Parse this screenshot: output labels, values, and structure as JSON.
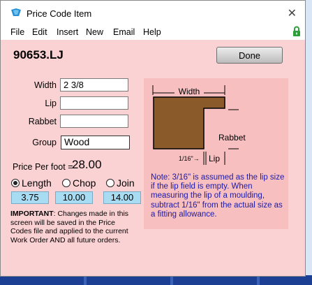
{
  "window": {
    "title": "Price Code Item",
    "close_glyph": "✕"
  },
  "menu": {
    "items": [
      "File",
      "Edit",
      "Insert",
      "New",
      "Email",
      "Help"
    ]
  },
  "item": {
    "code": "90653.LJ"
  },
  "toolbar": {
    "done_label": "Done"
  },
  "fields": {
    "width_label": "Width",
    "width_value": "2  3/8",
    "lip_label": "Lip",
    "lip_value": "",
    "rabbet_label": "Rabbet",
    "rabbet_value": "",
    "group_label": "Group",
    "group_value": "Wood"
  },
  "price": {
    "label": "Price Per foot =",
    "value": "28.00"
  },
  "pricing_options": [
    {
      "label": "Length",
      "value": "3.75",
      "selected": true
    },
    {
      "label": "Chop",
      "value": "10.00",
      "selected": false
    },
    {
      "label": "Join",
      "value": "14.00",
      "selected": false
    }
  ],
  "important_note": {
    "bold": "IMPORTANT",
    "text": ": Changes made in this screen will be saved in the Price Codes file and applied to the current Work Order AND all future orders."
  },
  "diagram": {
    "width_label": "Width",
    "rabbet_label": "Rabbet",
    "sixteenth_label": "1/16\"→",
    "lip_label": "Lip",
    "moulding_color": "#8b5a2b"
  },
  "note": {
    "text": "Note: 3/16\" is assumed as the lip size if the lip field is empty. When measuring the lip of a moulding, subtract 1/16\" from the actual size as a fitting allowance."
  },
  "colors": {
    "window_bg": "#fbd2d3",
    "panel_bg": "#f8bfc1",
    "note_text": "#1a1aa8",
    "value_box": "#a8dcf3",
    "lock": "#2e9e3a"
  },
  "icons": {
    "app": "paint-bucket-icon",
    "close": "close-icon",
    "lock": "lock-icon"
  }
}
